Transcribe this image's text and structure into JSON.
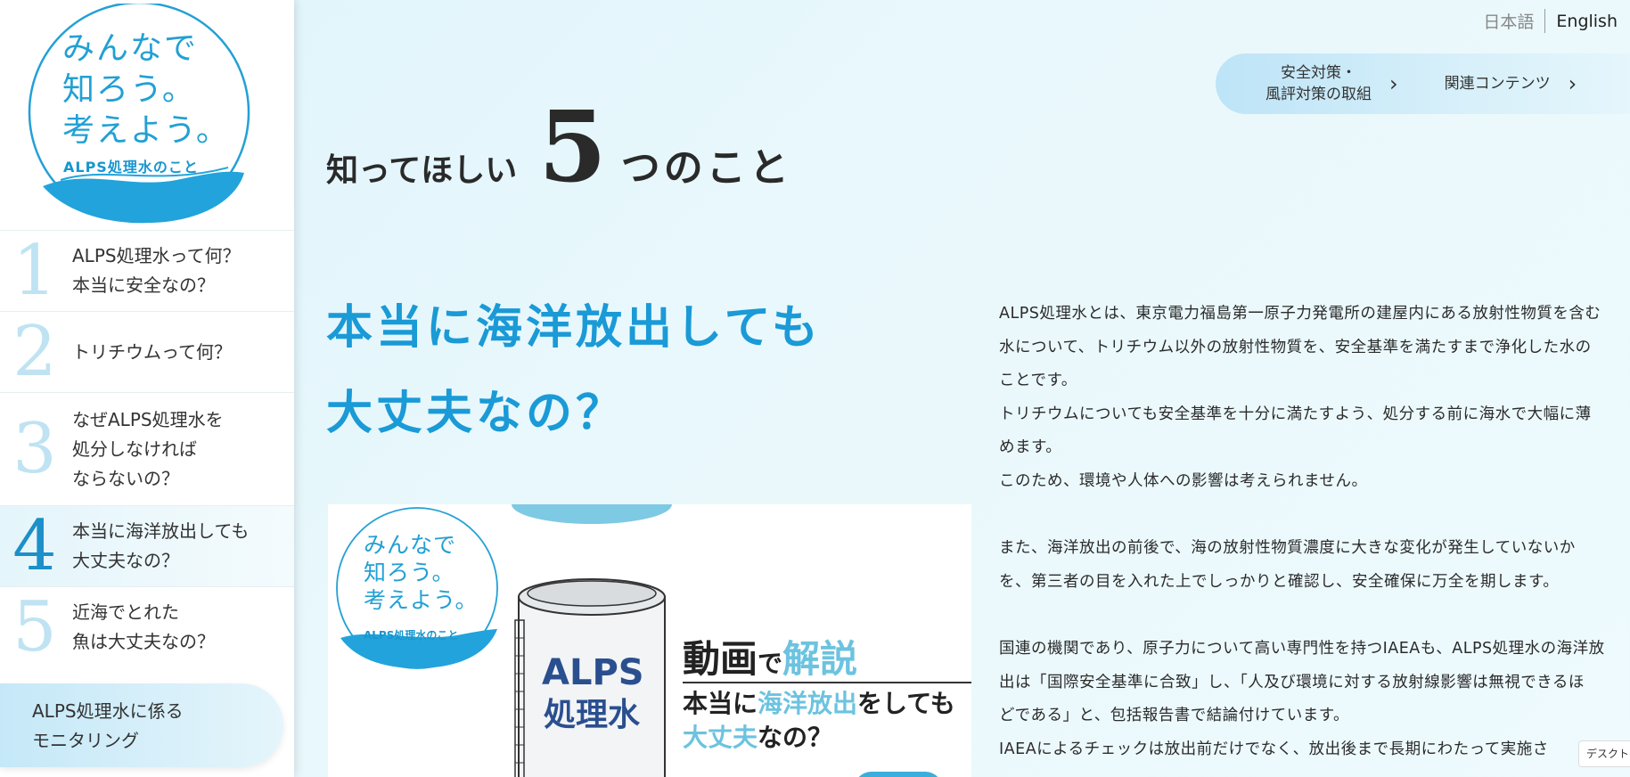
{
  "colors": {
    "accent": "#1a9ad6",
    "active_num": "#1d8fc9",
    "inactive_num": "#bfe3f2"
  },
  "logo": {
    "line1": "みんなで",
    "line2": "知ろう。",
    "line3": "考えよう。",
    "sub": "ALPS処理水のこと"
  },
  "sidebar": {
    "items": [
      {
        "num": "1",
        "label": "ALPS処理水って何？\n本当に安全なの？"
      },
      {
        "num": "2",
        "label": "トリチウムって何？"
      },
      {
        "num": "3",
        "label": "なぜALPS処理水を\n処分しなければ\nならないの？"
      },
      {
        "num": "4",
        "label": "本当に海洋放出しても\n大丈夫なの？"
      },
      {
        "num": "5",
        "label": "近海でとれた\n魚は大丈夫なの？"
      }
    ],
    "active_index": 3,
    "monitoring": "ALPS処理水に係る\nモニタリング"
  },
  "header": {
    "lang_ja": "日本語",
    "lang_en": "English",
    "nav": [
      {
        "label": "安全対策・\n風評対策の取組"
      },
      {
        "label": "関連コンテンツ"
      }
    ]
  },
  "main": {
    "title_pre": "知ってほしい",
    "title_num": "5",
    "title_post": "つのこと",
    "headline": "本当に海洋放出しても\n大丈夫なの？",
    "paragraphs": [
      [
        "ALPS処理水とは、東京電力福島第一原子力発電所の建屋内にある放射性物質を含む",
        "水について、トリチウム以外の放射性物質を、安全基準を満たすまで浄化した水の",
        "ことです。",
        "トリチウムについても安全基準を十分に満たすよう、処分する前に海水で大幅に薄",
        "めます。",
        "このため、環境や人体への影響は考えられません。"
      ],
      [
        "また、海洋放出の前後で、海の放射性物質濃度に大きな変化が発生していないか",
        "を、第三者の目を入れた上でしっかりと確認し、安全確保に万全を期します。"
      ],
      [
        "国連の機関であり、原子力について高い専門性を持つIAEAも、ALPS処理水の海洋放",
        "出は「国際安全基準に合致」し、「人及び環境に対する放射線影響は無視できるほ",
        "どである」と、包括報告書で結論付けています。",
        "IAEAによるチェックは放出前だけでなく、放出後まで長期にわたって実施さ"
      ]
    ],
    "video": {
      "logo1": "みんなで",
      "logo2": "知ろう。",
      "logo3": "考えよう。",
      "logo_sub": "ALPS処理水のこと",
      "tank_l1": "ALPS",
      "tank_l2": "処理水",
      "h1_a": "動画",
      "h1_b": "で",
      "h1_c": "解説",
      "h2_a": "本当に",
      "h2_b": "海洋放出",
      "h2_c": "をしても",
      "h2_d": "大丈夫",
      "h2_e": "なの？"
    }
  },
  "badge": "デスクトップ"
}
